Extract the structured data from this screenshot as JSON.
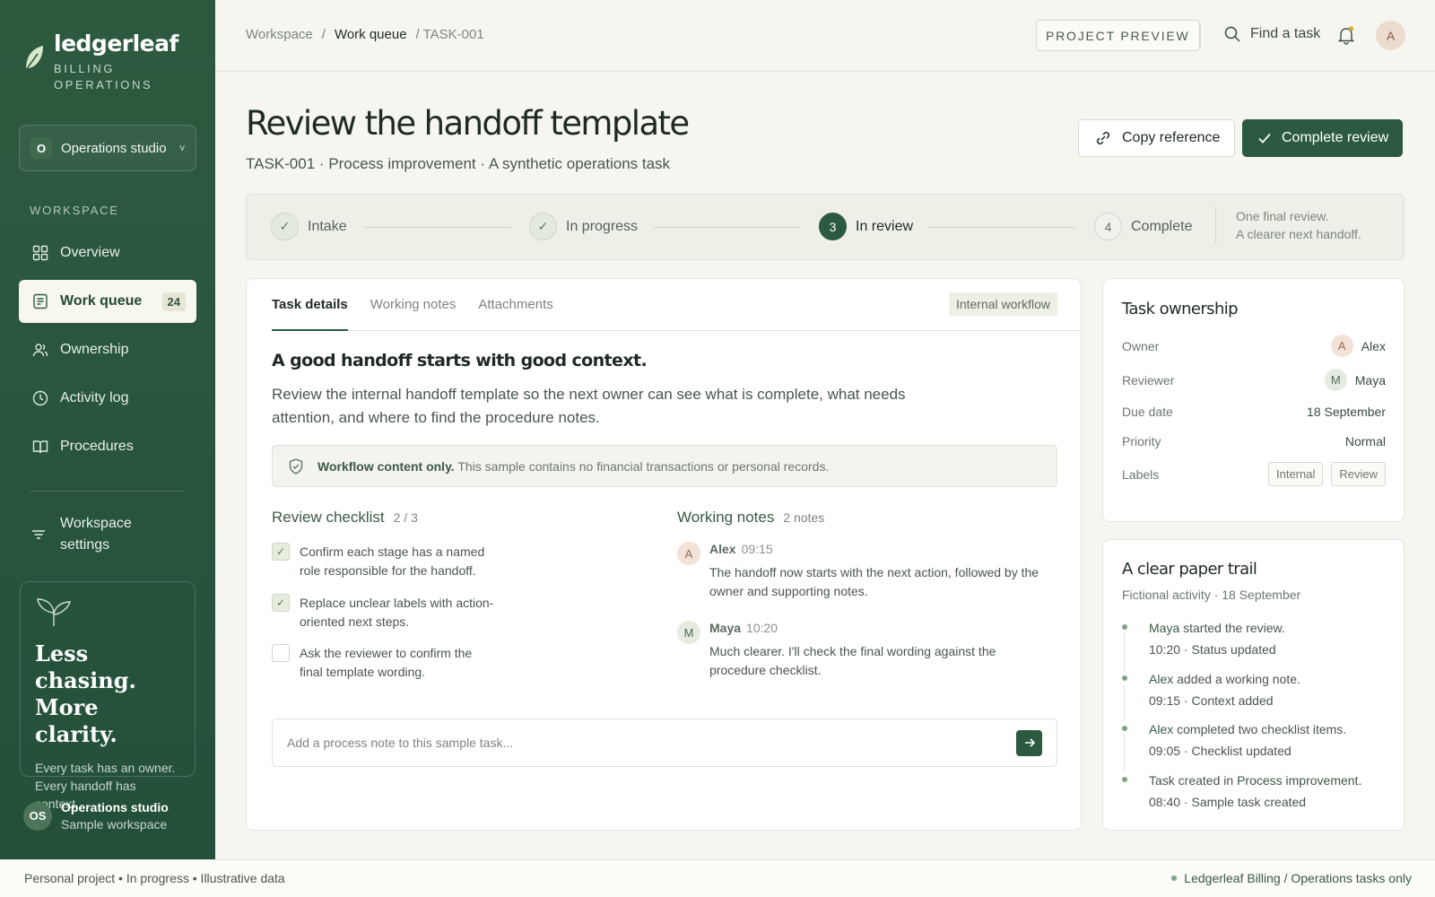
{
  "brand": {
    "name": "ledgerleaf",
    "sub": "BILLING OPERATIONS"
  },
  "org": {
    "badge": "O",
    "name": "Operations studio"
  },
  "nav": {
    "section": "WORKSPACE",
    "items": [
      {
        "label": "Overview"
      },
      {
        "label": "Work queue",
        "count": "24"
      },
      {
        "label": "Ownership"
      },
      {
        "label": "Activity log"
      },
      {
        "label": "Procedures"
      }
    ],
    "settings": "Workspace settings"
  },
  "promo": {
    "title": "Less chasing. More clarity.",
    "text": "Every task has an owner. Every handoff has context."
  },
  "user": {
    "initials": "OS",
    "name": "Operations studio",
    "sub": "Sample workspace"
  },
  "breadcrumb": {
    "root": "Workspace",
    "sep": "/",
    "middle": "Work queue",
    "current": "/ TASK-001"
  },
  "topbar": {
    "preview": "PROJECT PREVIEW",
    "find": "Find a task",
    "avatar": "A"
  },
  "header": {
    "title": "Review the handoff template",
    "subtitle": "TASK-001 · Process improvement · A synthetic operations task",
    "copy_label": "Copy reference",
    "complete_label": "Complete review"
  },
  "stepper": {
    "steps": [
      {
        "marker": "✓",
        "label": "Intake"
      },
      {
        "marker": "✓",
        "label": "In progress"
      },
      {
        "marker": "3",
        "label": "In review"
      },
      {
        "marker": "4",
        "label": "Complete"
      }
    ],
    "note_line1": "One final review.",
    "note_line2": "A clearer next handoff."
  },
  "tabs": {
    "items": [
      "Task details",
      "Working notes",
      "Attachments"
    ],
    "tag": "Internal workflow"
  },
  "details": {
    "title": "A good handoff starts with good context.",
    "text": "Review the internal handoff template so the next owner can see what is complete, what needs attention, and where to find the procedure notes.",
    "notice_bold": "Workflow content only.",
    "notice_text": "This sample contains no financial transactions or personal records."
  },
  "checklist": {
    "title": "Review checklist",
    "count": "2 / 3",
    "items": [
      {
        "text": "Confirm each stage has a named role responsible for the handoff.",
        "checked": "✓"
      },
      {
        "text": "Replace unclear labels with action-oriented next steps.",
        "checked": "✓"
      },
      {
        "text": "Ask the reviewer to confirm the final template wording.",
        "checked": ""
      }
    ]
  },
  "notes": {
    "title": "Working notes",
    "count": "2 notes",
    "items": [
      {
        "initial": "A",
        "author": "Alex",
        "time": "09:15",
        "text": "The handoff now starts with the next action, followed by the owner and supporting notes."
      },
      {
        "initial": "M",
        "author": "Maya",
        "time": "10:20",
        "text": "Much clearer. I'll check the final wording against the procedure checklist."
      }
    ]
  },
  "composer": {
    "placeholder": "Add a process note to this sample task..."
  },
  "ownership": {
    "title": "Task ownership",
    "owner_label": "Owner",
    "owner_initial": "A",
    "owner": "Alex",
    "reviewer_label": "Reviewer",
    "reviewer_initial": "M",
    "reviewer": "Maya",
    "due_label": "Due date",
    "due": "18 September",
    "priority_label": "Priority",
    "priority": "Normal",
    "labels_label": "Labels",
    "labels": [
      "Internal",
      "Review"
    ]
  },
  "trail": {
    "title": "A clear paper trail",
    "sub": "Fictional activity · 18 September",
    "items": [
      {
        "who": "Maya",
        "what": " started the review.",
        "meta": "10:20 · Status updated"
      },
      {
        "who": "Alex",
        "what": " added a working note.",
        "meta": "09:15 · Context added"
      },
      {
        "who": "Alex",
        "what": " completed two checklist items.",
        "meta": "09:05 · Checklist updated"
      },
      {
        "who": "Task created in ",
        "what": "Process improvement.",
        "meta": "08:40 · Sample task created"
      }
    ]
  },
  "footer": {
    "left": "Personal project • In progress • Illustrative data",
    "right": "Ledgerleaf Billing / Operations tasks only"
  },
  "colors": {
    "brand": "#2c5a40",
    "sidebar": "#2d5a3f",
    "accent_dot": "#7ea486"
  }
}
